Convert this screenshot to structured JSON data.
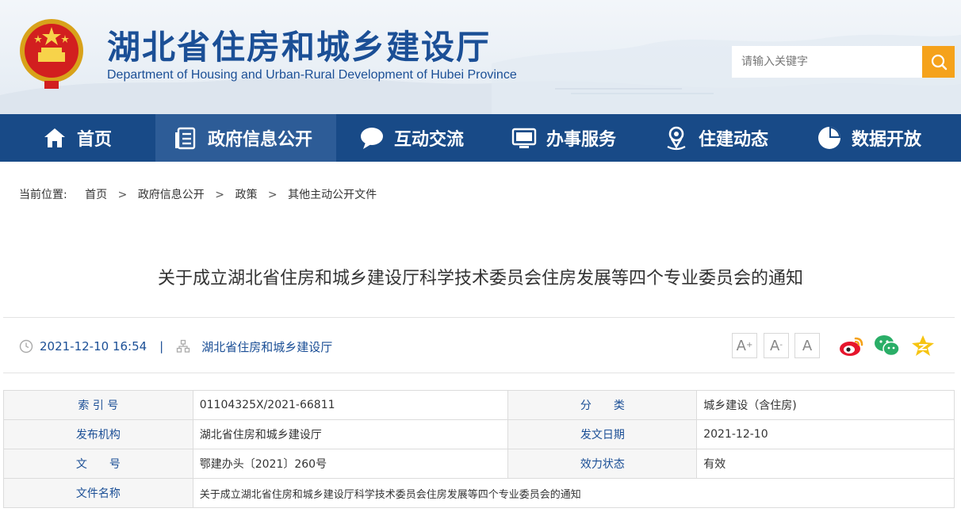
{
  "header": {
    "title": "湖北省住房和城乡建设厅",
    "subtitle": "Department of Housing and Urban-Rural Development of Hubei Province",
    "search_placeholder": "请输入关键字"
  },
  "nav": {
    "items": [
      {
        "label": "首页",
        "icon": "home-icon"
      },
      {
        "label": "政府信息公开",
        "icon": "document-list-icon",
        "active": true
      },
      {
        "label": "互动交流",
        "icon": "chat-bubble-icon"
      },
      {
        "label": "办事服务",
        "icon": "monitor-icon"
      },
      {
        "label": "住建动态",
        "icon": "location-pin-icon"
      },
      {
        "label": "数据开放",
        "icon": "pie-chart-icon"
      }
    ]
  },
  "breadcrumb": {
    "prefix": "当前位置:",
    "items": [
      "首页",
      "政府信息公开",
      "政策",
      "其他主动公开文件"
    ],
    "separator": ">"
  },
  "article": {
    "title": "关于成立湖北省住房和城乡建设厅科学技术委员会住房发展等四个专业委员会的通知",
    "datetime": "2021-12-10 16:54",
    "divider": "|",
    "source": "湖北省住房和城乡建设厅"
  },
  "font_controls": {
    "increase": "A",
    "decrease": "A",
    "reset": "A"
  },
  "share": [
    "weibo-icon",
    "wechat-icon",
    "qzone-icon"
  ],
  "info_table": {
    "rows": [
      {
        "k1": "索 引 号",
        "v1": "01104325X/2021-66811",
        "k2": "分　　类",
        "v2": "城乡建设（含住房)"
      },
      {
        "k1": "发布机构",
        "v1": "湖北省住房和城乡建设厅",
        "k2": "发文日期",
        "v2": "2021-12-10"
      },
      {
        "k1": "文　　号",
        "v1": "鄂建办头〔2021〕260号",
        "k2": "效力状态",
        "v2": "有效"
      }
    ],
    "doc_name_label": "文件名称",
    "doc_name": "关于成立湖北省住房和城乡建设厅科学技术委员会住房发展等四个专业委员会的通知"
  },
  "colors": {
    "nav_bg": "#184a87",
    "nav_active": "#2d5c97",
    "brand_blue": "#1b4f96",
    "search_button": "#f5a21b"
  }
}
